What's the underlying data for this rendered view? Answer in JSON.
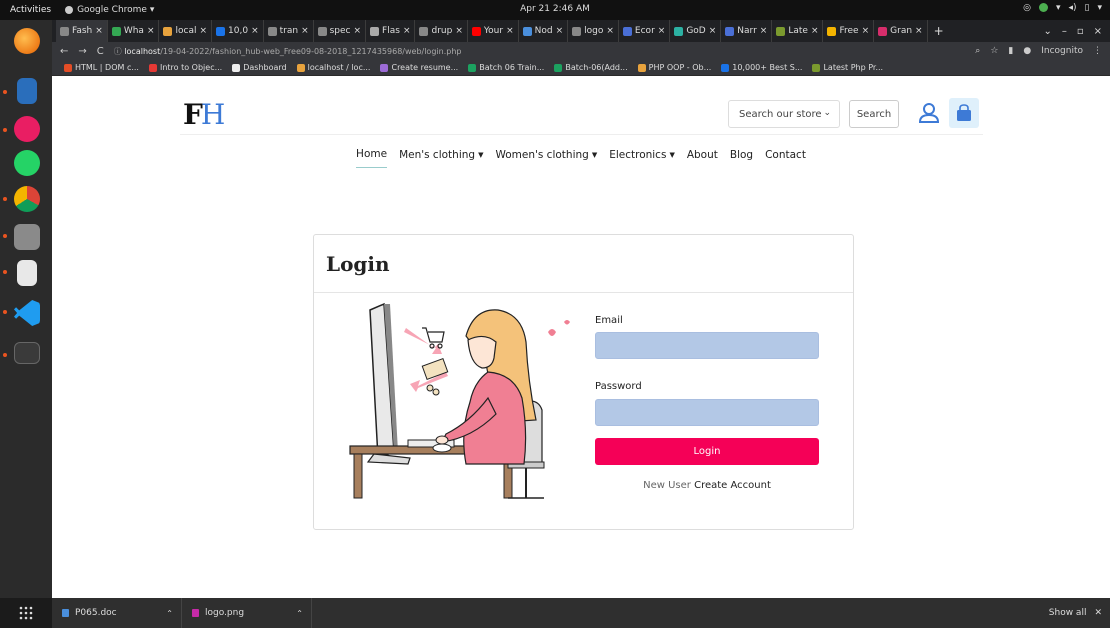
{
  "system": {
    "activities": "Activities",
    "app_name": "Google Chrome ▾",
    "clock": "Apr 21  2:46 AM"
  },
  "tabs": [
    {
      "label": "Fash",
      "color": "#888"
    },
    {
      "label": "Wha",
      "color": "#34a853"
    },
    {
      "label": "local",
      "color": "#e8a33d"
    },
    {
      "label": "10,0",
      "color": "#1a73e8"
    },
    {
      "label": "tran",
      "color": "#888"
    },
    {
      "label": "spec",
      "color": "#888"
    },
    {
      "label": "Flas",
      "color": "#aaa"
    },
    {
      "label": "drup",
      "color": "#888"
    },
    {
      "label": "Your",
      "color": "#ff0000"
    },
    {
      "label": "Nod",
      "color": "#4a8fdd"
    },
    {
      "label": "logo",
      "color": "#888"
    },
    {
      "label": "Ecor",
      "color": "#4a6fd6"
    },
    {
      "label": "GoD",
      "color": "#2cb1a3"
    },
    {
      "label": "Narr",
      "color": "#4a6fd6"
    },
    {
      "label": "Late",
      "color": "#7b9a2e"
    },
    {
      "label": "Free",
      "color": "#f4b400"
    },
    {
      "label": "Gran",
      "color": "#d62d6b"
    }
  ],
  "address_bar": {
    "host": "localhost",
    "path": "/19-04-2022/fashion_hub-web_Free09-08-2018_1217435968/web/login.php",
    "incognito": "Incognito"
  },
  "bookmarks": [
    {
      "label": "HTML | DOM c...",
      "color": "#e44d26"
    },
    {
      "label": "Intro to Objec...",
      "color": "#e53935"
    },
    {
      "label": "Dashboard",
      "color": "#eee"
    },
    {
      "label": "localhost / loc...",
      "color": "#e8a33d"
    },
    {
      "label": "Create resume...",
      "color": "#9c6bd6"
    },
    {
      "label": "Batch 06 Train...",
      "color": "#1ca260"
    },
    {
      "label": "Batch-06(Add...",
      "color": "#1ca260"
    },
    {
      "label": "PHP OOP - Ob...",
      "color": "#e8a33d"
    },
    {
      "label": "10,000+ Best S...",
      "color": "#1a73e8"
    },
    {
      "label": "Latest Php Pr...",
      "color": "#7b9a2e"
    }
  ],
  "header": {
    "logo_f": "F",
    "logo_h": "H",
    "search_select": "Search our store",
    "search_button": "Search"
  },
  "nav": {
    "home": "Home",
    "mens": "Men's clothing",
    "womens": "Women's clothing",
    "electronics": "Electronics",
    "about": "About",
    "blog": "Blog",
    "contact": "Contact"
  },
  "login": {
    "title": "Login",
    "email_label": "Email",
    "email_value": "",
    "password_label": "Password",
    "password_value": "",
    "button": "Login",
    "new_user": "New User",
    "create_account": "Create Account"
  },
  "downloads": [
    {
      "label": "P065.doc",
      "color": "#4a8fdd"
    },
    {
      "label": "logo.png",
      "color": "#c62aa8"
    }
  ],
  "downloads_show_all": "Show all",
  "colors": {
    "accent": "#f50057",
    "input_fill": "#b3c8e6",
    "cart_bg": "#dff0fb",
    "icon_blue": "#3d7ad6"
  }
}
